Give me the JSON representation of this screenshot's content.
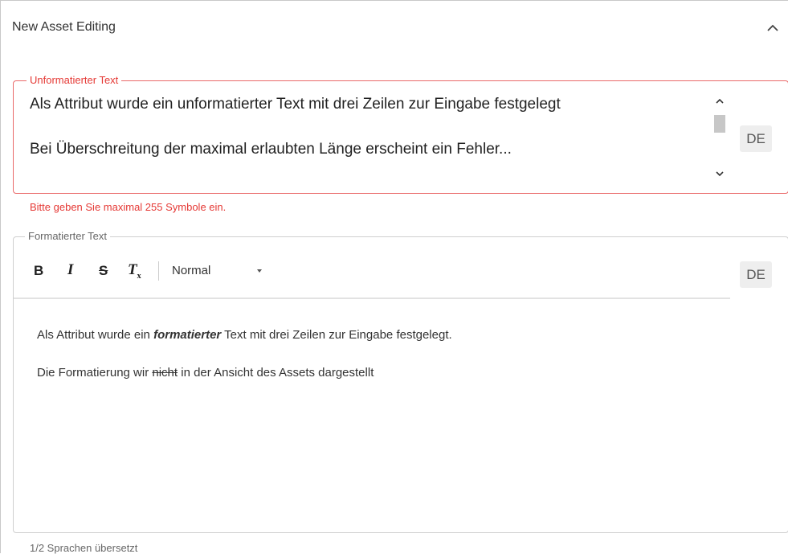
{
  "panel": {
    "title": "New Asset Editing"
  },
  "plain_field": {
    "legend": "Unformatierter Text",
    "lines": [
      "Als Attribut wurde ein unformatierter Text mit drei Zeilen zur Eingabe festgelegt",
      "Bei Überschreitung der maximal erlaubten Länge erscheint ein Fehler..."
    ],
    "language": "DE",
    "error": "Bitte geben Sie maximal 255 Symbole ein."
  },
  "rich_field": {
    "legend": "Formatierter Text",
    "toolbar": {
      "bold": "B",
      "italic": "I",
      "strike": "S",
      "clear": "T",
      "clear_sub": "x",
      "format": "Normal"
    },
    "language": "DE",
    "line1": {
      "before": "Als Attribut wurde ein ",
      "emphasis": "formatierter",
      "after": " Text mit drei Zeilen zur Eingabe festgelegt."
    },
    "line2": {
      "before": "Die Formatierung wir ",
      "strike": "nicht",
      "after": " in der Ansicht des Assets dargestellt"
    }
  },
  "footer": {
    "translation_status": "1/2 Sprachen übersetzt"
  },
  "colors": {
    "error": "#e53935",
    "border": "#cfcfcf"
  }
}
